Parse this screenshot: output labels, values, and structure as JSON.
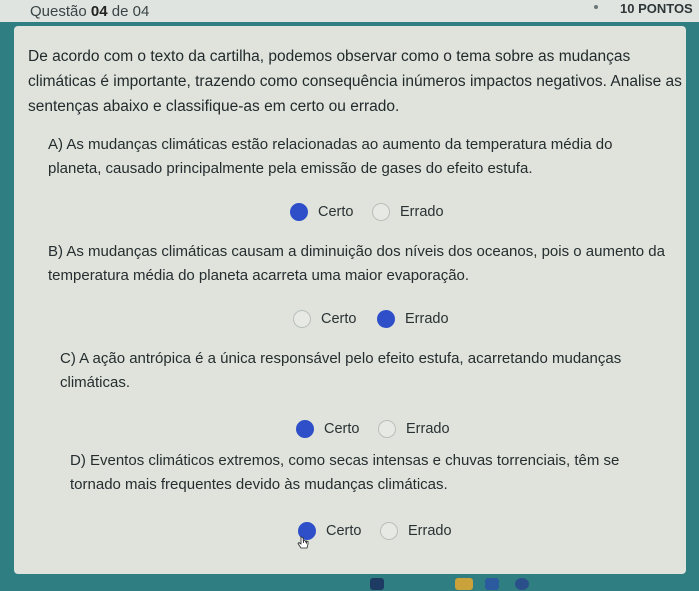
{
  "header": {
    "question_prefix": "Questão",
    "question_number": "04",
    "question_suffix": "de 04",
    "points": "10 PONTOS"
  },
  "intro": "De acordo com o texto da cartilha, podemos observar como o tema sobre as mudanças climáticas é importante, trazendo como consequência inúmeros impactos negativos. Analise as sentenças abaixo e classifique-as em certo ou errado.",
  "statements": [
    {
      "text": "A) As mudanças climáticas estão relacionadas ao aumento da temperatura média do planeta, causado principalmente pela emissão de gases do efeito estufa.",
      "option_true": "Certo",
      "option_false": "Errado",
      "selected": "Certo"
    },
    {
      "text": "B) As mudanças climáticas causam a diminuição dos níveis dos oceanos, pois o aumento da temperatura média do planeta acarreta uma maior evaporação.",
      "option_true": "Certo",
      "option_false": "Errado",
      "selected": "Errado"
    },
    {
      "text": "C) A ação antrópica é a única responsável pelo efeito estufa, acarretando mudanças climáticas.",
      "option_true": "Certo",
      "option_false": "Errado",
      "selected": "Certo"
    },
    {
      "text": "D) Eventos climáticos extremos, como secas intensas e chuvas torrenciais, têm se tornado mais frequentes devido às mudanças climáticas.",
      "option_true": "Certo",
      "option_false": "Errado",
      "selected": "Certo"
    }
  ],
  "colors": {
    "selected": "#2f4fc9",
    "card": "#dfe3dc",
    "background": "#2f7f82"
  }
}
